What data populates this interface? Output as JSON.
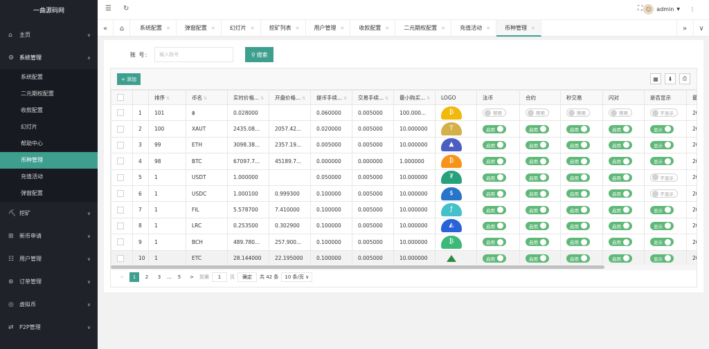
{
  "sidebar": {
    "logo": "一曲源码网",
    "items_top": [
      {
        "label": "主页"
      },
      {
        "label": "系统管理"
      }
    ],
    "submenu": [
      {
        "label": "系统配置"
      },
      {
        "label": "二元期权配置"
      },
      {
        "label": "收款配置"
      },
      {
        "label": "幻灯片"
      },
      {
        "label": "帮助中心"
      },
      {
        "label": "币种管理"
      },
      {
        "label": "充值活动"
      },
      {
        "label": "弹窗配置"
      }
    ],
    "items_bottom": [
      {
        "label": "挖矿"
      },
      {
        "label": "新币申请"
      },
      {
        "label": "用户管理"
      },
      {
        "label": "订单管理"
      },
      {
        "label": "虚拟币"
      },
      {
        "label": "P2P管理"
      }
    ]
  },
  "header": {
    "username": "admin"
  },
  "tabs": [
    {
      "label": "系统配置"
    },
    {
      "label": "弹窗配置"
    },
    {
      "label": "幻灯片"
    },
    {
      "label": "挖矿列表"
    },
    {
      "label": "用户管理"
    },
    {
      "label": "收款配置"
    },
    {
      "label": "二元期权配置"
    },
    {
      "label": "充值活动"
    },
    {
      "label": "币种管理"
    }
  ],
  "search": {
    "label": "账 号:",
    "placeholder": "输入账号",
    "button": "搜索"
  },
  "toolbar": {
    "add_label": "添加"
  },
  "table": {
    "columns": [
      "排序",
      "币名",
      "实时价格...",
      "开盘价格...",
      "提币手续...",
      "交易手续...",
      "最小购买...",
      "LOGO",
      "法币",
      "合约",
      "秒交易",
      "闪对",
      "是否显示",
      "最"
    ],
    "rows": [
      {
        "idx": "1",
        "sort": "101",
        "name": "฿",
        "price": "0.028000",
        "open": "",
        "wfee": "0.060000",
        "tfee": "0.005000",
        "min": "100.000...",
        "logo_color": "#f0b90b",
        "logo_glyph": "₿",
        "fabi": "禁用",
        "heyue": "禁用",
        "miao": "禁用",
        "shan": "禁用",
        "show": "不显示",
        "last": "20",
        "on": false
      },
      {
        "idx": "2",
        "sort": "100",
        "name": "XAUT",
        "price": "2435.08...",
        "open": "2057.42...",
        "wfee": "0.020000",
        "tfee": "0.005000",
        "min": "10.000000",
        "logo_color": "#d4b04a",
        "logo_glyph": "T",
        "fabi": "启用",
        "heyue": "启用",
        "miao": "启用",
        "shan": "启用",
        "show": "显示",
        "last": "20",
        "on": true
      },
      {
        "idx": "3",
        "sort": "99",
        "name": "ETH",
        "price": "3098.38...",
        "open": "2357.19...",
        "wfee": "0.005000",
        "tfee": "0.005000",
        "min": "10.000000",
        "logo_color": "#4a5fc1",
        "logo_glyph": "▲",
        "fabi": "启用",
        "heyue": "启用",
        "miao": "启用",
        "shan": "启用",
        "show": "显示",
        "last": "20",
        "on": true
      },
      {
        "idx": "4",
        "sort": "98",
        "name": "BTC",
        "price": "67097.7...",
        "open": "45189.7...",
        "wfee": "0.000000",
        "tfee": "0.000000",
        "min": "1.000000",
        "logo_color": "#f7931a",
        "logo_glyph": "₿",
        "fabi": "启用",
        "heyue": "启用",
        "miao": "启用",
        "shan": "启用",
        "show": "显示",
        "last": "20",
        "on": true
      },
      {
        "idx": "5",
        "sort": "1",
        "name": "USDT",
        "price": "1.000000",
        "open": "",
        "wfee": "0.050000",
        "tfee": "0.005000",
        "min": "10.000000",
        "logo_color": "#26a17b",
        "logo_glyph": "₮",
        "fabi": "启用",
        "heyue": "启用",
        "miao": "启用",
        "shan": "启用",
        "show": "不显示",
        "last": "20",
        "on": true
      },
      {
        "idx": "6",
        "sort": "1",
        "name": "USDC",
        "price": "1.000100",
        "open": "0.999300",
        "wfee": "0.100000",
        "tfee": "0.005000",
        "min": "10.000000",
        "logo_color": "#2775ca",
        "logo_glyph": "$",
        "fabi": "启用",
        "heyue": "启用",
        "miao": "启用",
        "shan": "启用",
        "show": "不显示",
        "last": "20",
        "on": true
      },
      {
        "idx": "7",
        "sort": "1",
        "name": "FIL",
        "price": "5.578700",
        "open": "7.410000",
        "wfee": "0.100000",
        "tfee": "0.005000",
        "min": "10.000000",
        "logo_color": "#42c1ca",
        "logo_glyph": "ƒ",
        "fabi": "启用",
        "heyue": "启用",
        "miao": "启用",
        "shan": "启用",
        "show": "显示",
        "last": "20",
        "on": true
      },
      {
        "idx": "8",
        "sort": "1",
        "name": "LRC",
        "price": "0.253500",
        "open": "0.302900",
        "wfee": "0.100000",
        "tfee": "0.005000",
        "min": "10.000000",
        "logo_color": "#2a62d8",
        "logo_glyph": "◭",
        "fabi": "启用",
        "heyue": "启用",
        "miao": "启用",
        "shan": "启用",
        "show": "显示",
        "last": "20",
        "on": true
      },
      {
        "idx": "9",
        "sort": "1",
        "name": "BCH",
        "price": "489.780...",
        "open": "257.900...",
        "wfee": "0.100000",
        "tfee": "0.005000",
        "min": "10.000000",
        "logo_color": "#3cb878",
        "logo_glyph": "₿",
        "fabi": "启用",
        "heyue": "启用",
        "miao": "启用",
        "shan": "启用",
        "show": "显示",
        "last": "20",
        "on": true
      },
      {
        "idx": "10",
        "sort": "1",
        "name": "ETC",
        "price": "28.144000",
        "open": "22.195000",
        "wfee": "0.100000",
        "tfee": "0.005000",
        "min": "10.000000",
        "logo_color": "#2f8a43",
        "logo_glyph": "",
        "fabi": "启用",
        "heyue": "启用",
        "miao": "启用",
        "shan": "启用",
        "show": "显示",
        "last": "20",
        "on": true
      }
    ]
  },
  "pager": {
    "prev": "<",
    "pages": [
      "1",
      "2",
      "3"
    ],
    "ellipsis": "…",
    "last_page": "5",
    "next": ">",
    "goto_label": "到第",
    "goto_value": "1",
    "page_unit": "页",
    "confirm": "确定",
    "total": "共 42 条",
    "per_page": "10 条/页"
  },
  "colors": {
    "accent": "#3e9f8f",
    "switch_on": "#5fb878",
    "sidebar_bg": "#20222a"
  }
}
